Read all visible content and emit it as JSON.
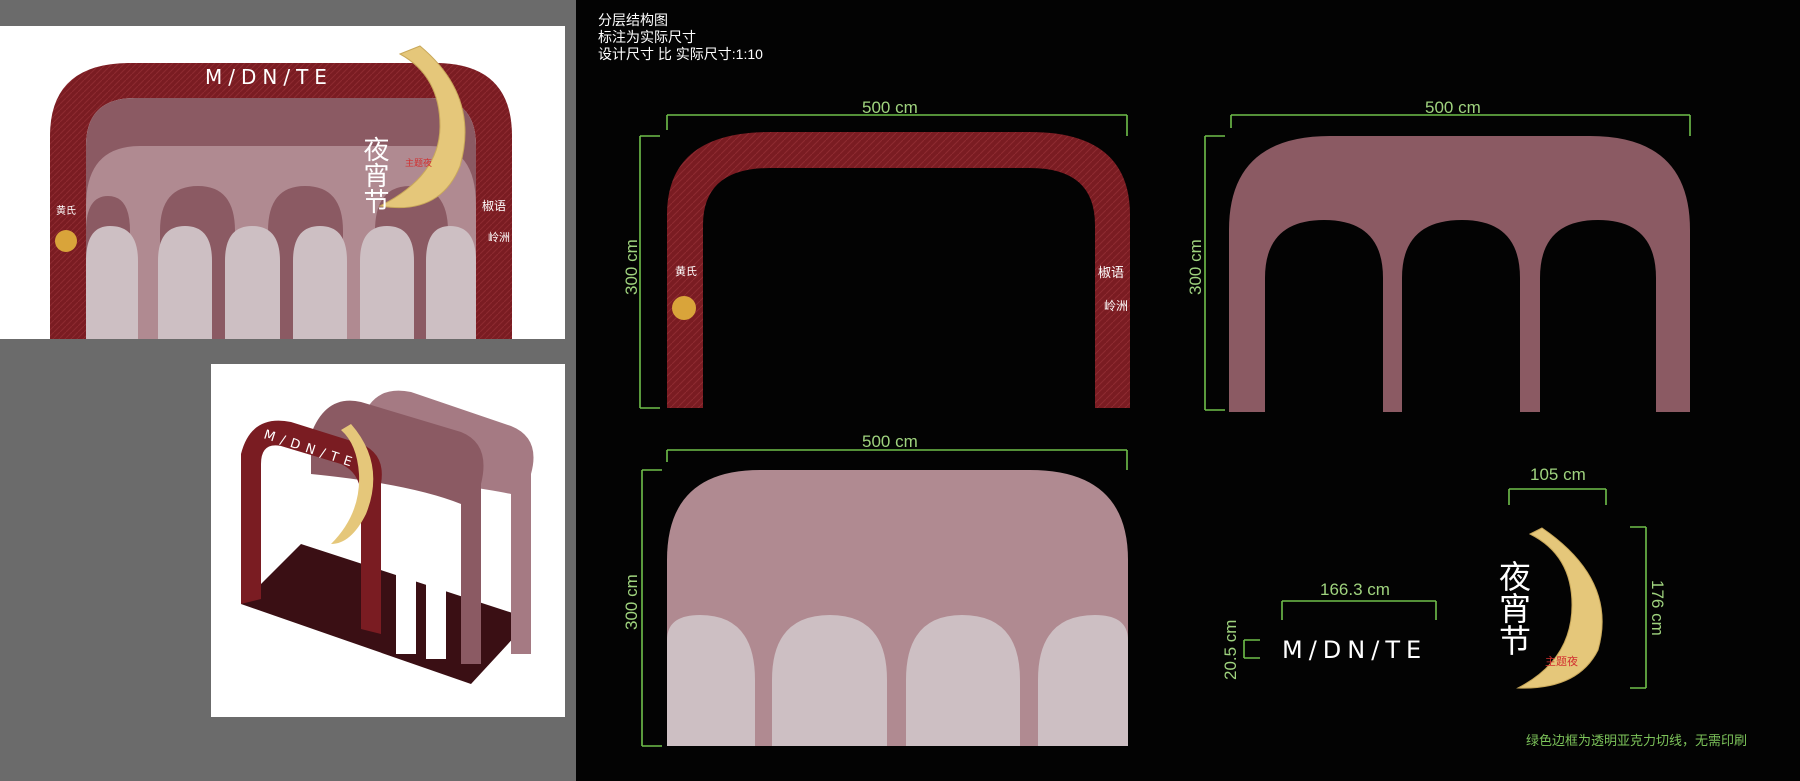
{
  "notes": {
    "line1": "分层结构图",
    "line2": "标注为实际尺寸",
    "line3": "设计尺寸 比 实际尺寸:1:10"
  },
  "brand": {
    "logo": "M/DN/TE",
    "moon_title": "夜宵节",
    "moon_subtitle": "主题夜",
    "side_right_1": "椒语",
    "side_right_2": "岭洲",
    "side_left_1": "黄氏"
  },
  "dimensions": {
    "layer1_width": "500 cm",
    "layer1_height": "300 cm",
    "layer2_width": "500 cm",
    "layer2_height": "300 cm",
    "layer3_width": "500 cm",
    "layer3_height": "300 cm",
    "logo_width": "166.3 cm",
    "logo_height": "20.5 cm",
    "moon_width": "105 cm",
    "moon_height": "176 cm"
  },
  "footnote": "绿色边框为透明亚克力切线，无需印刷",
  "colors": {
    "arch_red": "#7a1c22",
    "arch_mauve": "#8b5a63",
    "arch_pink": "#b08a91",
    "arch_light": "#cdbfc3",
    "moon_gold": "#e5c77a",
    "dim_green": "#6fbf4a"
  }
}
